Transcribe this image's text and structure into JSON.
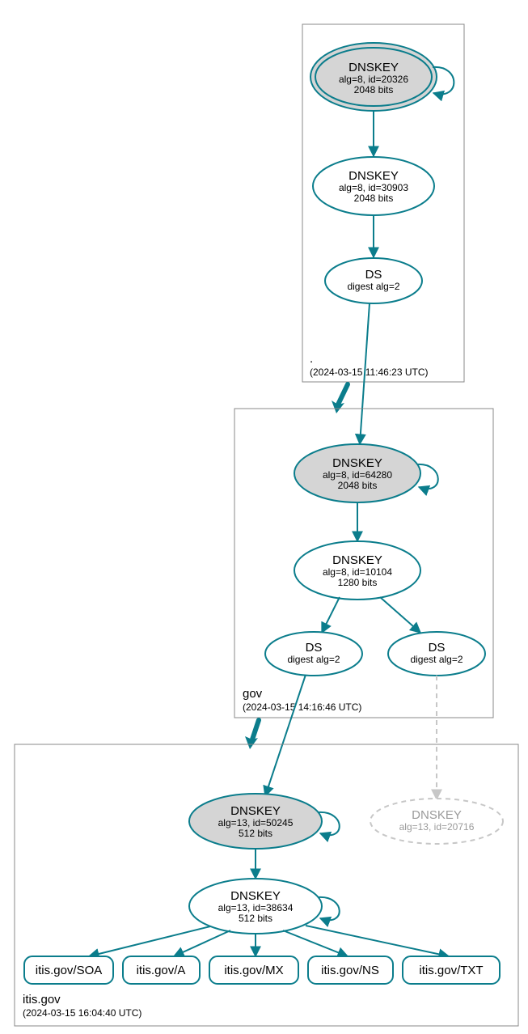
{
  "zones": {
    "root": {
      "label": ".",
      "timestamp": "(2024-03-15 11:46:23 UTC)"
    },
    "gov": {
      "label": "gov",
      "timestamp": "(2024-03-15 14:16:46 UTC)"
    },
    "itis": {
      "label": "itis.gov",
      "timestamp": "(2024-03-15 16:04:40 UTC)"
    }
  },
  "nodes": {
    "root_ksk": {
      "title": "DNSKEY",
      "line2": "alg=8, id=20326",
      "line3": "2048 bits"
    },
    "root_zsk": {
      "title": "DNSKEY",
      "line2": "alg=8, id=30903",
      "line3": "2048 bits"
    },
    "root_ds": {
      "title": "DS",
      "line2": "digest alg=2"
    },
    "gov_ksk": {
      "title": "DNSKEY",
      "line2": "alg=8, id=64280",
      "line3": "2048 bits"
    },
    "gov_zsk": {
      "title": "DNSKEY",
      "line2": "alg=8, id=10104",
      "line3": "1280 bits"
    },
    "gov_ds1": {
      "title": "DS",
      "line2": "digest alg=2"
    },
    "gov_ds2": {
      "title": "DS",
      "line2": "digest alg=2"
    },
    "itis_ksk": {
      "title": "DNSKEY",
      "line2": "alg=13, id=50245",
      "line3": "512 bits"
    },
    "itis_zsk": {
      "title": "DNSKEY",
      "line2": "alg=13, id=38634",
      "line3": "512 bits"
    },
    "itis_missing": {
      "title": "DNSKEY",
      "line2": "alg=13, id=20716"
    }
  },
  "rr": {
    "soa": "itis.gov/SOA",
    "a": "itis.gov/A",
    "mx": "itis.gov/MX",
    "ns": "itis.gov/NS",
    "txt": "itis.gov/TXT"
  },
  "chart_data": {
    "type": "table",
    "title": "DNSSEC validation chain for itis.gov",
    "zones": [
      {
        "name": ".",
        "timestamp_utc": "2024-03-15 11:46:23"
      },
      {
        "name": "gov",
        "timestamp_utc": "2024-03-15 14:16:46"
      },
      {
        "name": "itis.gov",
        "timestamp_utc": "2024-03-15 16:04:40"
      }
    ],
    "keys": [
      {
        "id": "root_ksk",
        "zone": ".",
        "type": "DNSKEY",
        "alg": 8,
        "key_id": 20326,
        "bits": 2048,
        "sep": true
      },
      {
        "id": "root_zsk",
        "zone": ".",
        "type": "DNSKEY",
        "alg": 8,
        "key_id": 30903,
        "bits": 2048,
        "sep": false
      },
      {
        "id": "root_ds",
        "zone": ".",
        "type": "DS",
        "digest_alg": 2
      },
      {
        "id": "gov_ksk",
        "zone": "gov",
        "type": "DNSKEY",
        "alg": 8,
        "key_id": 64280,
        "bits": 2048,
        "sep": true
      },
      {
        "id": "gov_zsk",
        "zone": "gov",
        "type": "DNSKEY",
        "alg": 8,
        "key_id": 10104,
        "bits": 1280,
        "sep": false
      },
      {
        "id": "gov_ds1",
        "zone": "gov",
        "type": "DS",
        "digest_alg": 2
      },
      {
        "id": "gov_ds2",
        "zone": "gov",
        "type": "DS",
        "digest_alg": 2
      },
      {
        "id": "itis_ksk",
        "zone": "itis.gov",
        "type": "DNSKEY",
        "alg": 13,
        "key_id": 50245,
        "bits": 512,
        "sep": true
      },
      {
        "id": "itis_zsk",
        "zone": "itis.gov",
        "type": "DNSKEY",
        "alg": 13,
        "key_id": 38634,
        "bits": 512,
        "sep": false
      },
      {
        "id": "itis_missing",
        "zone": "itis.gov",
        "type": "DNSKEY",
        "alg": 13,
        "key_id": 20716,
        "status": "unresolved"
      }
    ],
    "rrsets": [
      "itis.gov/SOA",
      "itis.gov/A",
      "itis.gov/MX",
      "itis.gov/NS",
      "itis.gov/TXT"
    ],
    "edges": [
      {
        "from": "root_ksk",
        "to": "root_ksk",
        "kind": "self-sign"
      },
      {
        "from": "root_ksk",
        "to": "root_zsk",
        "kind": "signs"
      },
      {
        "from": "root_zsk",
        "to": "root_ds",
        "kind": "signs"
      },
      {
        "from": "root_ds",
        "to": "gov_ksk",
        "kind": "ds-link"
      },
      {
        "from": "gov_ksk",
        "to": "gov_ksk",
        "kind": "self-sign"
      },
      {
        "from": "gov_ksk",
        "to": "gov_zsk",
        "kind": "signs"
      },
      {
        "from": "gov_zsk",
        "to": "gov_ds1",
        "kind": "signs"
      },
      {
        "from": "gov_zsk",
        "to": "gov_ds2",
        "kind": "signs"
      },
      {
        "from": "gov_ds1",
        "to": "itis_ksk",
        "kind": "ds-link"
      },
      {
        "from": "gov_ds2",
        "to": "itis_missing",
        "kind": "ds-link",
        "status": "unresolved"
      },
      {
        "from": "itis_ksk",
        "to": "itis_ksk",
        "kind": "self-sign"
      },
      {
        "from": "itis_ksk",
        "to": "itis_zsk",
        "kind": "signs"
      },
      {
        "from": "itis_zsk",
        "to": "itis_zsk",
        "kind": "self-sign"
      },
      {
        "from": "itis_zsk",
        "to": "itis.gov/SOA",
        "kind": "signs"
      },
      {
        "from": "itis_zsk",
        "to": "itis.gov/A",
        "kind": "signs"
      },
      {
        "from": "itis_zsk",
        "to": "itis.gov/MX",
        "kind": "signs"
      },
      {
        "from": "itis_zsk",
        "to": "itis.gov/NS",
        "kind": "signs"
      },
      {
        "from": "itis_zsk",
        "to": "itis.gov/TXT",
        "kind": "signs"
      }
    ]
  }
}
